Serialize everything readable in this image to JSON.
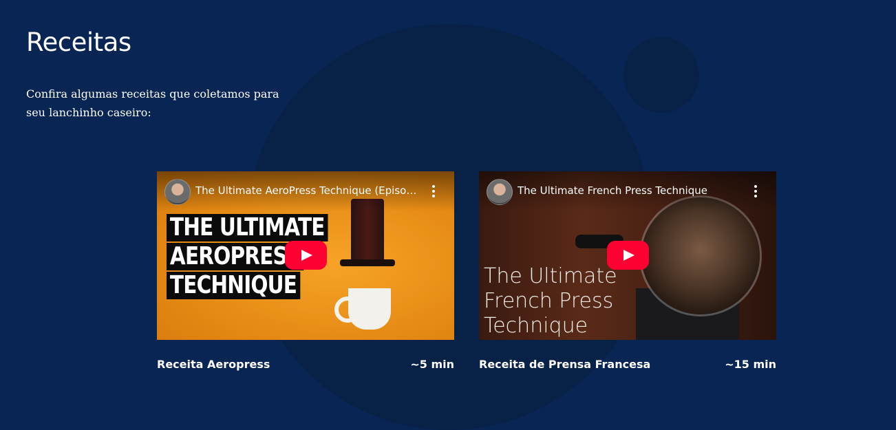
{
  "section": {
    "title": "Receitas",
    "intro": "Confira algumas receitas que coletamos para seu lanchinho caseiro:"
  },
  "colors": {
    "background": "#082553",
    "decor_circle": "#072147",
    "play_button": "#ff0033",
    "text": "#ffffff"
  },
  "videos": [
    {
      "video_title": "The Ultimate AeroPress Technique (Episod...",
      "thumbnail_text": [
        "THE ULTIMATE",
        "AEROPRESS",
        "TECHNIQUE"
      ],
      "recipe_name": "Receita Aeropress",
      "duration": "~5 min",
      "icons": [
        "avatar",
        "more-vert-icon",
        "youtube-play-icon"
      ]
    },
    {
      "video_title": "The Ultimate French Press Technique",
      "thumbnail_text": [
        "The Ultimate",
        "French Press",
        "Technique"
      ],
      "recipe_name": "Receita de Prensa Francesa",
      "duration": "~15 min",
      "icons": [
        "avatar",
        "more-vert-icon",
        "youtube-play-icon"
      ]
    }
  ]
}
